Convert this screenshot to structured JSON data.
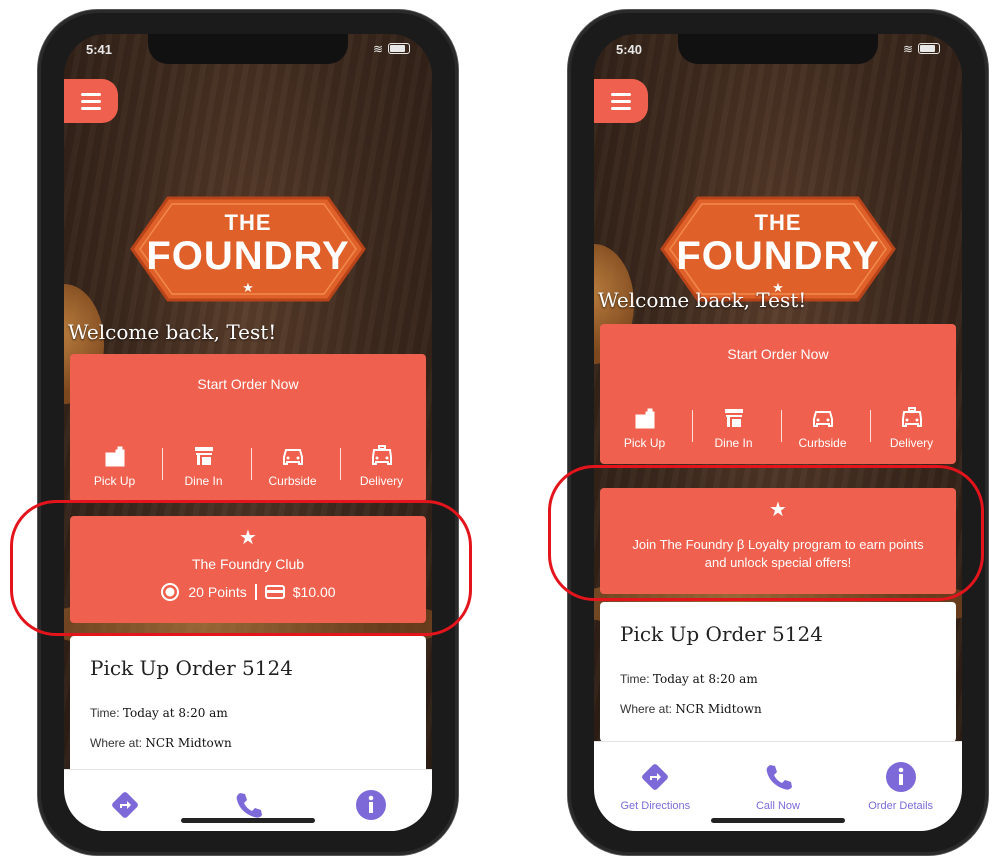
{
  "left": {
    "status_time": "5:41",
    "logo": {
      "the": "THE",
      "foundry": "FOUNDRY",
      "star": "★"
    },
    "welcome": "Welcome back, Test!",
    "order_card": {
      "title": "Start Order Now",
      "methods": [
        {
          "label": "Pick Up",
          "icon": "shopping-bag-icon"
        },
        {
          "label": "Dine In",
          "icon": "storefront-icon"
        },
        {
          "label": "Curbside",
          "icon": "car-front-icon"
        },
        {
          "label": "Delivery",
          "icon": "taxi-icon"
        }
      ]
    },
    "loyalty": {
      "star": "★",
      "name": "The Foundry Club",
      "points": "20 Points",
      "balance": "$10.00"
    },
    "order_info": {
      "title": "Pick Up Order 5124",
      "time_label": "Time:",
      "time_value": "Today at 8:20 am",
      "where_label": "Where at:",
      "where_value": "NCR Midtown"
    }
  },
  "right": {
    "status_time": "5:40",
    "logo": {
      "the": "THE",
      "foundry": "FOUNDRY",
      "star": "★"
    },
    "welcome": "Welcome back, Test!",
    "order_card": {
      "title": "Start Order Now",
      "methods": [
        {
          "label": "Pick Up",
          "icon": "shopping-bag-icon"
        },
        {
          "label": "Dine In",
          "icon": "storefront-icon"
        },
        {
          "label": "Curbside",
          "icon": "car-front-icon"
        },
        {
          "label": "Delivery",
          "icon": "taxi-icon"
        }
      ]
    },
    "loyalty": {
      "star": "★",
      "message": "Join The Foundry β Loyalty program to earn points and unlock special offers!"
    },
    "order_info": {
      "title": "Pick Up Order 5124",
      "time_label": "Time:",
      "time_value": "Today at 8:20 am",
      "where_label": "Where at:",
      "where_value": "NCR Midtown"
    },
    "tabs": [
      {
        "label": "Get Directions",
        "icon": "directions-icon"
      },
      {
        "label": "Call Now",
        "icon": "phone-icon"
      },
      {
        "label": "Order Details",
        "icon": "info-icon"
      }
    ]
  },
  "colors": {
    "accent": "#f0604e",
    "tab_icon": "#7d6ad8",
    "highlight": "#e3141b"
  }
}
